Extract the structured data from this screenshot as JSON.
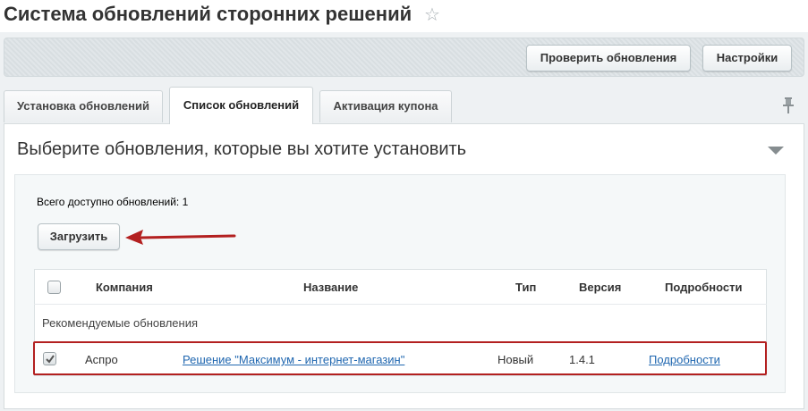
{
  "header": {
    "title": "Система обновлений сторонних решений"
  },
  "toolbar": {
    "check_updates_label": "Проверить обновления",
    "settings_label": "Настройки"
  },
  "tabs": [
    {
      "label": "Установка обновлений",
      "active": false
    },
    {
      "label": "Список обновлений",
      "active": true
    },
    {
      "label": "Активация купона",
      "active": false
    }
  ],
  "panel": {
    "heading": "Выберите обновления, которые вы хотите установить",
    "total_label": "Всего доступно обновлений: 1",
    "load_label": "Загрузить"
  },
  "table": {
    "columns": [
      "Компания",
      "Название",
      "Тип",
      "Версия",
      "Подробности"
    ],
    "group_label": "Рекомендуемые обновления",
    "rows": [
      {
        "checked": true,
        "company": "Аспро",
        "name": "Решение \"Максимум - интернет-магазин\"",
        "type": "Новый",
        "version": "1.4.1",
        "details": "Подробности"
      }
    ]
  },
  "colors": {
    "highlight": "#b32020",
    "link": "#2067b0"
  }
}
